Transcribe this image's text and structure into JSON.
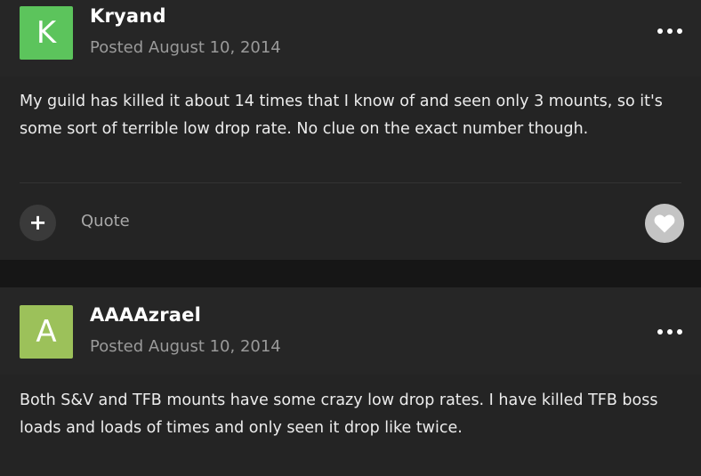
{
  "posts": [
    {
      "avatar_letter": "K",
      "avatar_color": "#5cc45c",
      "author": "Kryand",
      "posted": "Posted August 10, 2014",
      "menu_icon": "ellipsis-icon",
      "body": "My guild has killed it about 14 times that I know of and seen only 3 mounts, so it's some sort of terrible low drop rate. No clue on the exact number though.",
      "actions": {
        "add_icon": "plus-icon",
        "add_label": "+",
        "quote_label": "Quote",
        "like_icon": "heart-icon"
      }
    },
    {
      "avatar_letter": "A",
      "avatar_color": "#9cc15a",
      "author": "AAAAzrael",
      "posted": "Posted August 10, 2014",
      "menu_icon": "ellipsis-icon",
      "body": "Both S&V and TFB mounts have some crazy low drop rates. I have killed TFB boss loads and loads of times and only seen it drop like twice."
    }
  ]
}
